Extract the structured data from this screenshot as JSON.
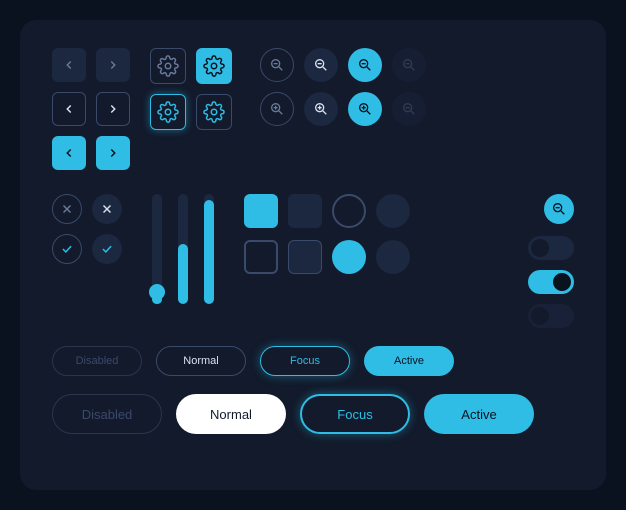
{
  "colors": {
    "accent": "#2fbde6",
    "panel": "#121a2b",
    "bg": "#0a1220",
    "muted": "#1c2740",
    "stroke": "#3a4a6a"
  },
  "sliders": [
    {
      "value": 8,
      "knob": true
    },
    {
      "value": 55,
      "knob": false
    },
    {
      "value": 95,
      "knob": false
    }
  ],
  "toggles": [
    {
      "state": "off"
    },
    {
      "state": "on"
    },
    {
      "state": "off-dim"
    }
  ],
  "buttons_small": {
    "disabled": "Disabled",
    "normal": "Normal",
    "focus": "Focus",
    "active": "Active"
  },
  "buttons_large": {
    "disabled": "Disabled",
    "normal": "Normal",
    "focus": "Focus",
    "active": "Active"
  }
}
